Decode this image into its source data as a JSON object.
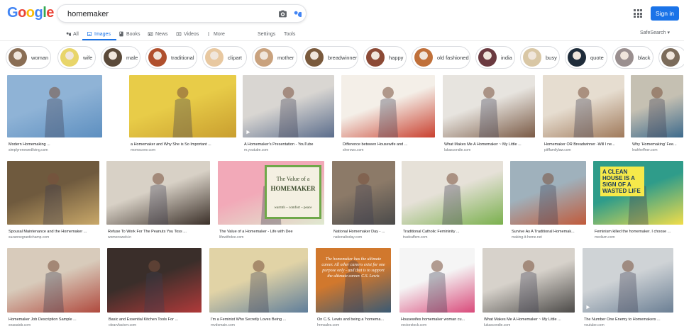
{
  "header": {
    "logo": [
      "G",
      "o",
      "o",
      "g",
      "l",
      "e"
    ],
    "logo_colors": [
      "#4285f4",
      "#ea4335",
      "#fbbc05",
      "#4285f4",
      "#34a853",
      "#ea4335"
    ],
    "search_value": "homemaker",
    "signin_label": "Sign in"
  },
  "tabs": {
    "all": "All",
    "images": "Images",
    "books": "Books",
    "news": "News",
    "videos": "Videos",
    "more": "More",
    "settings": "Settings",
    "tools": "Tools",
    "safesearch": "SafeSearch ▾"
  },
  "chips": [
    {
      "label": "woman",
      "color": "#8a6e55"
    },
    {
      "label": "wife",
      "color": "#e8d56a"
    },
    {
      "label": "male",
      "color": "#5b4a3a"
    },
    {
      "label": "traditional",
      "color": "#b0502e"
    },
    {
      "label": "clipart",
      "color": "#e8c8a0"
    },
    {
      "label": "mother",
      "color": "#c9a27e"
    },
    {
      "label": "breadwinner",
      "color": "#7a5a3d"
    },
    {
      "label": "happy",
      "color": "#8c4a36"
    },
    {
      "label": "old fashioned",
      "color": "#c0703a"
    },
    {
      "label": "india",
      "color": "#6b3a40"
    },
    {
      "label": "busy",
      "color": "#d9c7a5"
    },
    {
      "label": "quote",
      "color": "#1f2c3a"
    },
    {
      "label": "black",
      "color": "#9a8f8f"
    },
    {
      "label": "",
      "color": "#7b6b5a"
    }
  ],
  "results": {
    "row1": [
      {
        "caption": "Modern Homemaking ...",
        "source": "simplyrenewedliving.com",
        "c1": "#8fb3d6",
        "c2": "#5d8fc0"
      },
      {
        "caption": "a Homemaker and Why She is So Important ...",
        "source": "momscove.com",
        "c1": "#e8cc48",
        "c2": "#c99e2f"
      },
      {
        "caption": "A Homemaker's Presentation - YouTube",
        "source": "m.youtube.com",
        "c1": "#d9d6d2",
        "c2": "#5b6d8c"
      },
      {
        "caption": "Difference between Housewife and ...",
        "source": "sherows.com",
        "c1": "#f4efe8",
        "c2": "#c9402f"
      },
      {
        "caption": "What Makes Me A Homemaker ~ My Little ...",
        "source": "lukascondie.com",
        "c1": "#e7e4df",
        "c2": "#7a5a45"
      },
      {
        "caption": "Homemaker OR Breadwinner -Will I ne...",
        "source": "pitffamilylaw.com",
        "c1": "#e6ddd0",
        "c2": "#a07a5b"
      },
      {
        "caption": "Why 'Homemaking' Fee...",
        "source": "leahheffner.com",
        "c1": "#c5c0b2",
        "c2": "#3d6a8c"
      }
    ],
    "row2": [
      {
        "caption": "Spousal Maintenance and the Homemaker ...",
        "source": "suzannegrantichamp.com",
        "c1": "#6f5a3e",
        "c2": "#c9a869"
      },
      {
        "caption": "Refuse To Work For The Peanuts You Toss ...",
        "source": "womensweb.in",
        "c1": "#d8d1c6",
        "c2": "#3b3029"
      },
      {
        "caption": "The Value of a Homemaker - Life with Dee",
        "source": "lifewithdee.com",
        "c1": "#f2a9b8",
        "c2": "#dfead0"
      },
      {
        "caption": "National Homemaker Day - ...",
        "source": "nationaltoday.com",
        "c1": "#8c7a68",
        "c2": "#4a4a4a"
      },
      {
        "caption": "Traditional Catholic Femininity ...",
        "source": "tradcaffem.com",
        "c1": "#e6e1d8",
        "c2": "#7ab04d"
      },
      {
        "caption": "Survive As A Traditional Homemak...",
        "source": "making-it-home.net",
        "c1": "#9fb1bc",
        "c2": "#c15a3a"
      },
      {
        "caption": "Feminism killed the homemaker. I choose ...",
        "source": "medium.com",
        "c1": "#2f9c8a",
        "c2": "#f1dd4a"
      }
    ],
    "row3": [
      {
        "caption": "Homemaker Job Description Sample ...",
        "source": "snagajob.com",
        "c1": "#d8cbbb",
        "c2": "#b04a3e"
      },
      {
        "caption": "Basic and Essential Kitchen Tools For ...",
        "source": "olearyfactory.com",
        "c1": "#3a2e2a",
        "c2": "#b03a3a"
      },
      {
        "caption": "I'm a Feminist Who Secretly Loves Being ...",
        "source": "mydomain.com",
        "c1": "#e1d3a6",
        "c2": "#5f7e9b"
      },
      {
        "caption": "On C.S. Lewis and being a 'homema...",
        "source": "hrmsales.com",
        "c1": "#d1782d",
        "c2": "#3a5a74"
      },
      {
        "caption": "Housewifes homemaker woman cu...",
        "source": "vectorstock.com",
        "c1": "#f5f5f5",
        "c2": "#d94a7a"
      },
      {
        "caption": "What Makes Me A Homemaker ~ My Little ...",
        "source": "lukascondie.com",
        "c1": "#d7d2cb",
        "c2": "#4c4a48"
      },
      {
        "caption": "The Number One Enemy to Homemakers ...",
        "source": "youtube.com",
        "c1": "#cfd3d6",
        "c2": "#6b7f94"
      }
    ]
  },
  "quote_text": "The homemaker has the ultimate career. All other careers exist for one purpose only - and that is to support the ultimate career. C.S. Lewis",
  "poster_text": "A CLEAN HOUSE IS A SIGN OF A WASTED LIFE",
  "value_title": "The Value of a",
  "value_word": "HOMEMAKER",
  "value_sub": "warmth ~ comfort ~ peace",
  "accent": "#1a73e8"
}
